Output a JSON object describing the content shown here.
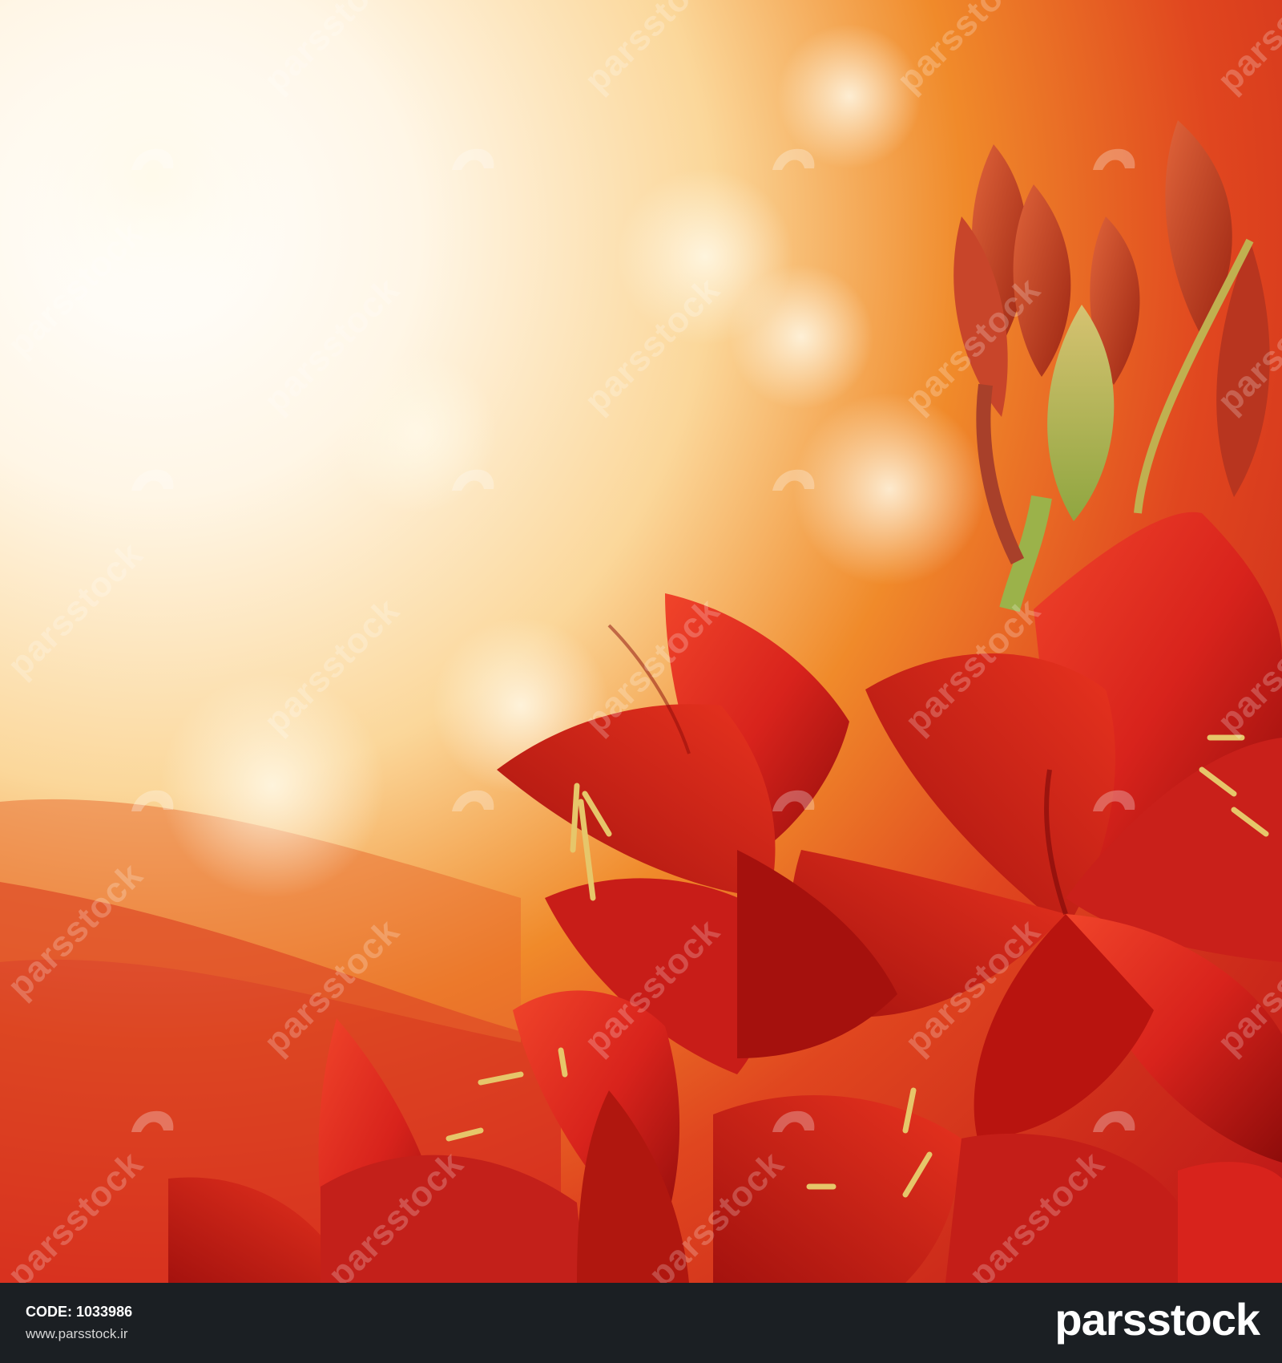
{
  "photo": {
    "subject": "red amaryllis flowers",
    "colors": {
      "glow": "#fff6e6",
      "orange": "#f08a2a",
      "red": "#d8231c",
      "deep_red": "#9c0f0c",
      "bud_green": "#b7a64a",
      "stamen": "#e6c66a"
    },
    "watermark": {
      "text": "parsstock",
      "icon": "horse-head-logo-icon"
    }
  },
  "footer": {
    "code_label": "CODE:",
    "code_value": "1033986",
    "website": "www.parsstock.ir",
    "brand": "parsstock",
    "background": "#1b1f23"
  }
}
